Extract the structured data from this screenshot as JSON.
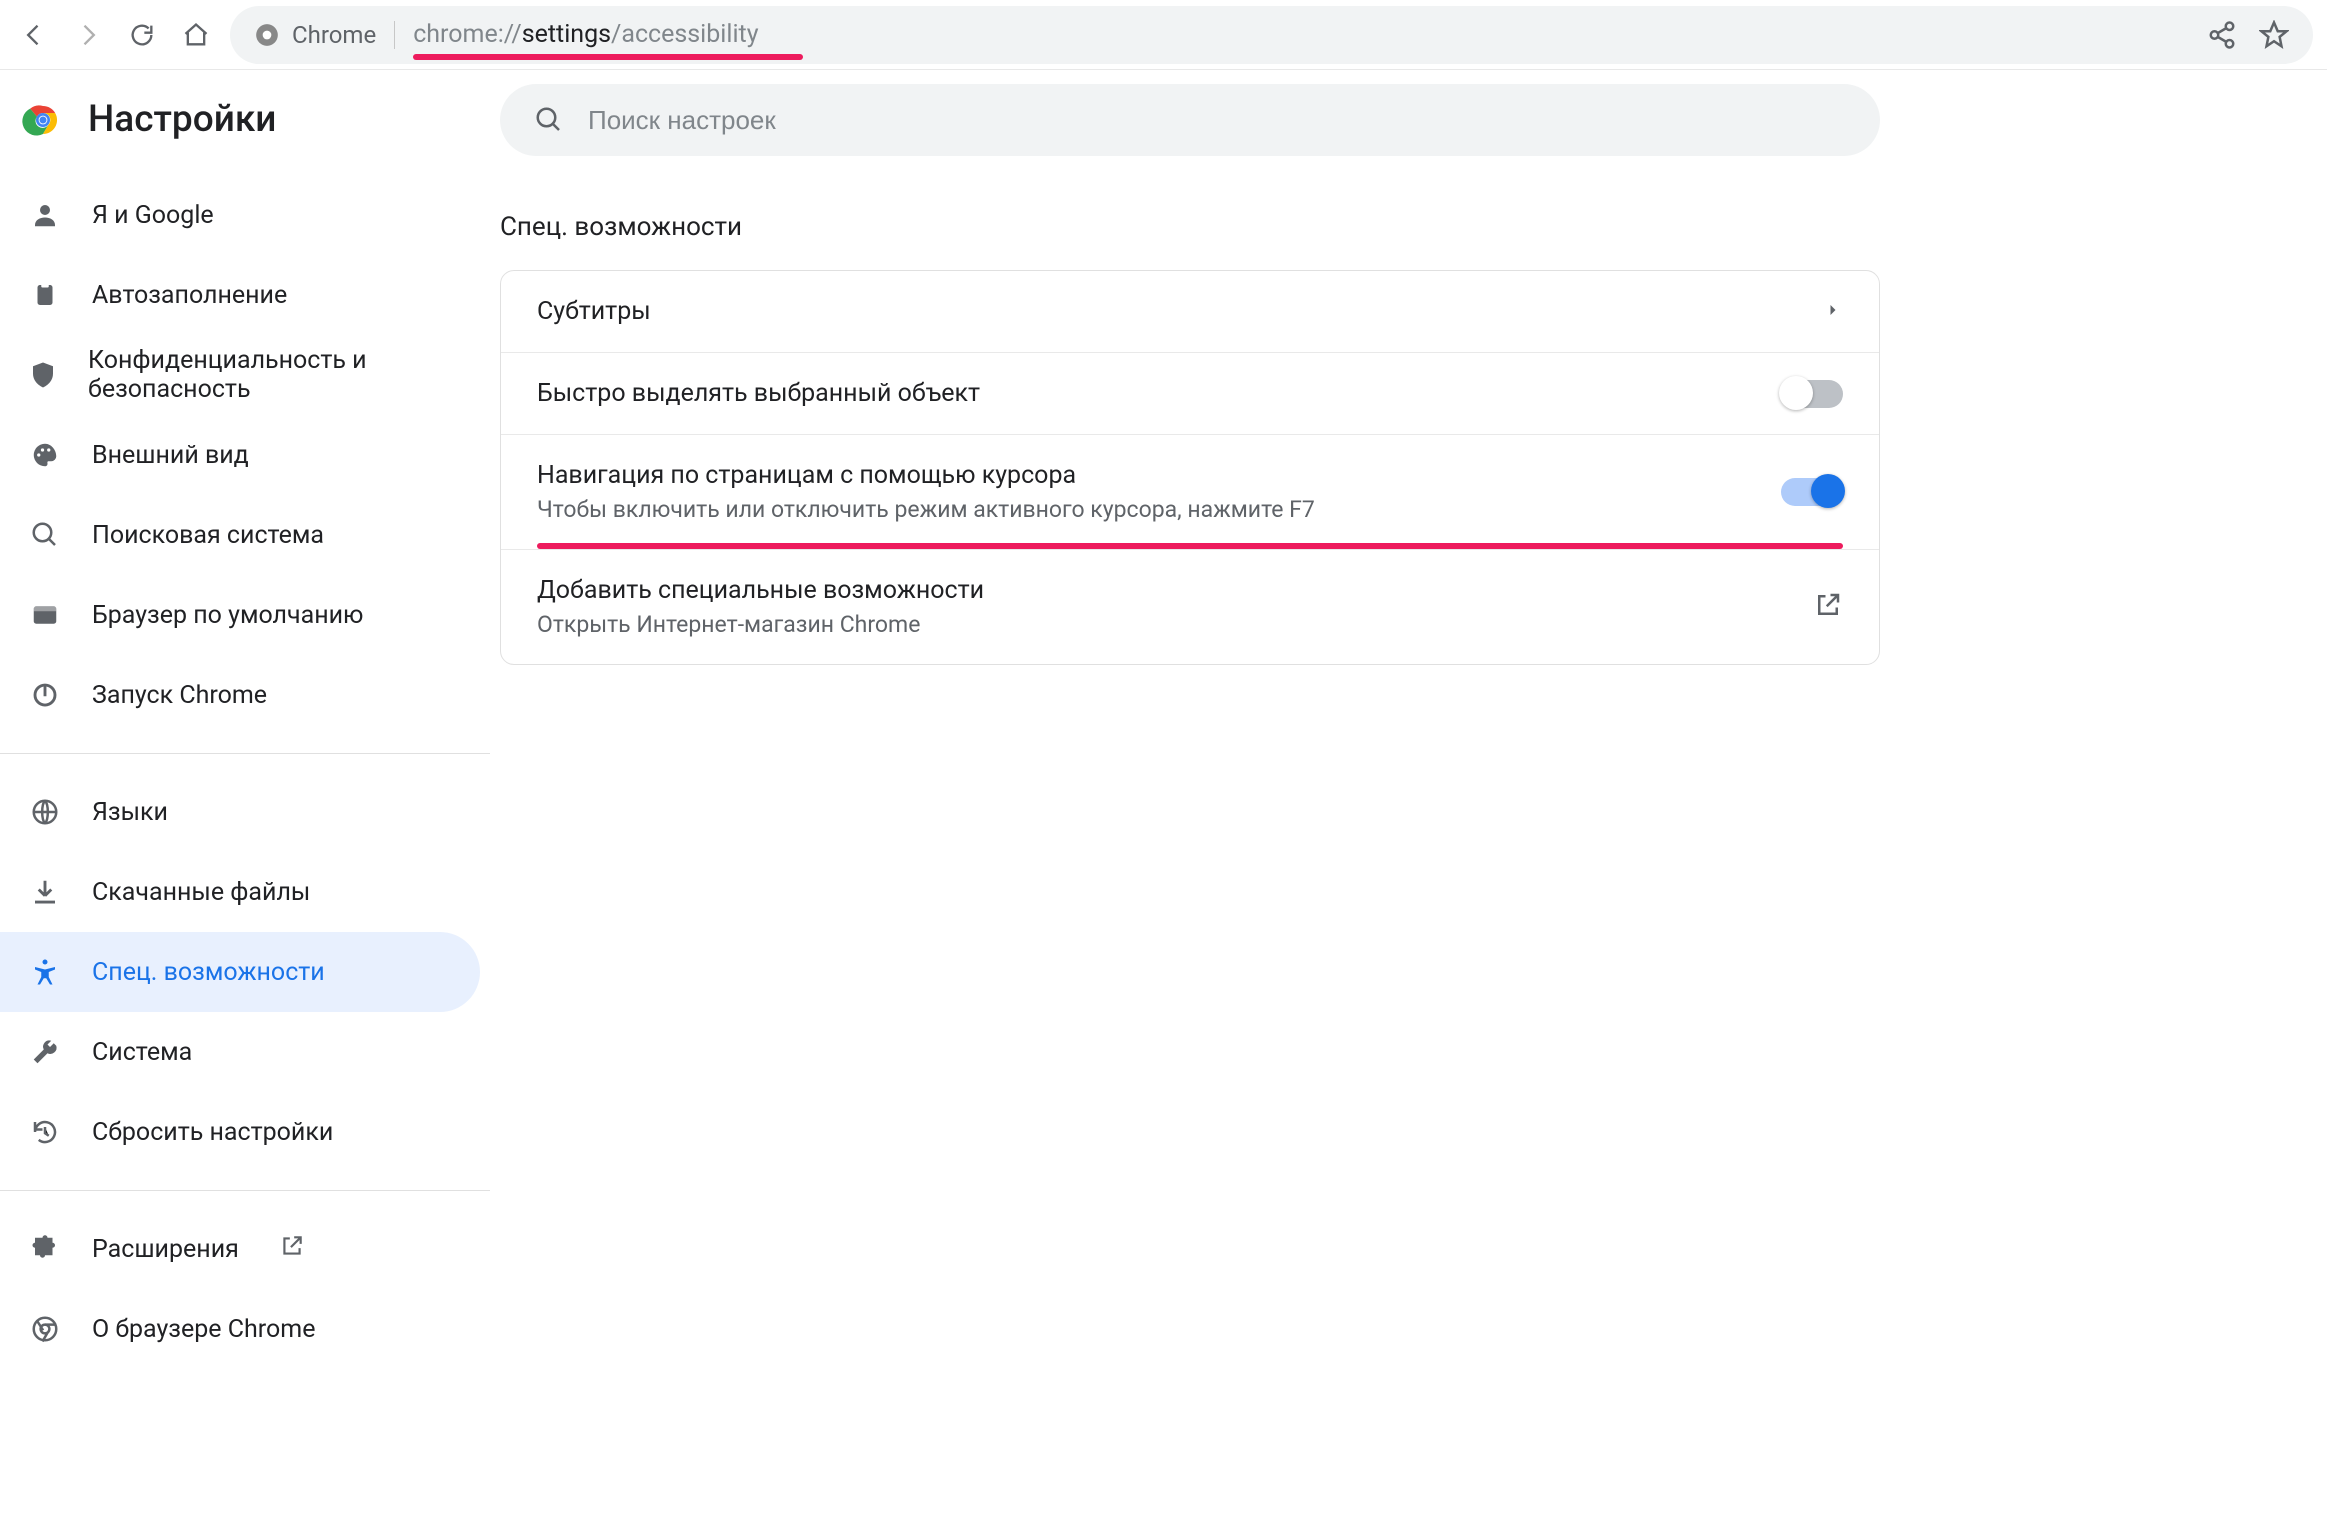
{
  "browser": {
    "chip_label": "Chrome",
    "url_prefix": "chrome://",
    "url_bold": "settings",
    "url_suffix": "/accessibility"
  },
  "header": {
    "title": "Настройки"
  },
  "sidebar": {
    "group1": [
      {
        "icon": "person",
        "label": "Я и Google"
      },
      {
        "icon": "clipboard",
        "label": "Автозаполнение"
      },
      {
        "icon": "shield",
        "label": "Конфиденциальность и безопасность"
      },
      {
        "icon": "palette",
        "label": "Внешний вид"
      },
      {
        "icon": "search",
        "label": "Поисковая система"
      },
      {
        "icon": "browser",
        "label": "Браузер по умолчанию"
      },
      {
        "icon": "power",
        "label": "Запуск Chrome"
      }
    ],
    "group2": [
      {
        "icon": "globe",
        "label": "Языки"
      },
      {
        "icon": "download",
        "label": "Скачанные файлы"
      },
      {
        "icon": "accessibility",
        "label": "Спец. возможности",
        "active": true
      },
      {
        "icon": "wrench",
        "label": "Система"
      },
      {
        "icon": "restore",
        "label": "Сбросить настройки"
      }
    ],
    "group3": [
      {
        "icon": "extension",
        "label": "Расширения",
        "external": true
      },
      {
        "icon": "chrome",
        "label": "О браузере Chrome"
      }
    ]
  },
  "search": {
    "placeholder": "Поиск настроек"
  },
  "section": {
    "title": "Спец. возможности"
  },
  "rows": {
    "captions": {
      "title": "Субтитры"
    },
    "highlight": {
      "title": "Быстро выделять выбранный объект",
      "on": false
    },
    "caret": {
      "title": "Навигация по страницам с помощью курсора",
      "sub": "Чтобы включить или отключить режим активного курсора, нажмите F7",
      "on": true
    },
    "add": {
      "title": "Добавить специальные возможности",
      "sub": "Открыть Интернет-магазин Chrome"
    }
  }
}
